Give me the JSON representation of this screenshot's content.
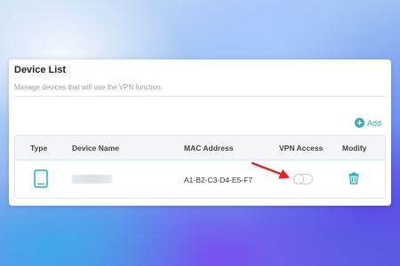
{
  "panel": {
    "title": "Device List",
    "description": "Manage devices that will use the VPN function.",
    "add_label": "Add"
  },
  "table": {
    "headers": {
      "type": "Type",
      "device_name": "Device Name",
      "mac_address": "MAC Address",
      "vpn_access": "VPN Access",
      "modify": "Modify"
    },
    "rows": [
      {
        "type_icon": "tablet-icon",
        "device_name": "",
        "mac_address": "A1-B2-C3-D4-E5-F7",
        "vpn_access": "off",
        "modify_icon": "trash-icon"
      }
    ]
  },
  "annotation": {
    "icon": "red-arrow-icon",
    "color": "#e02424"
  },
  "colors": {
    "accent": "#21b0bf",
    "toggle_border": "#c7cdd3"
  }
}
